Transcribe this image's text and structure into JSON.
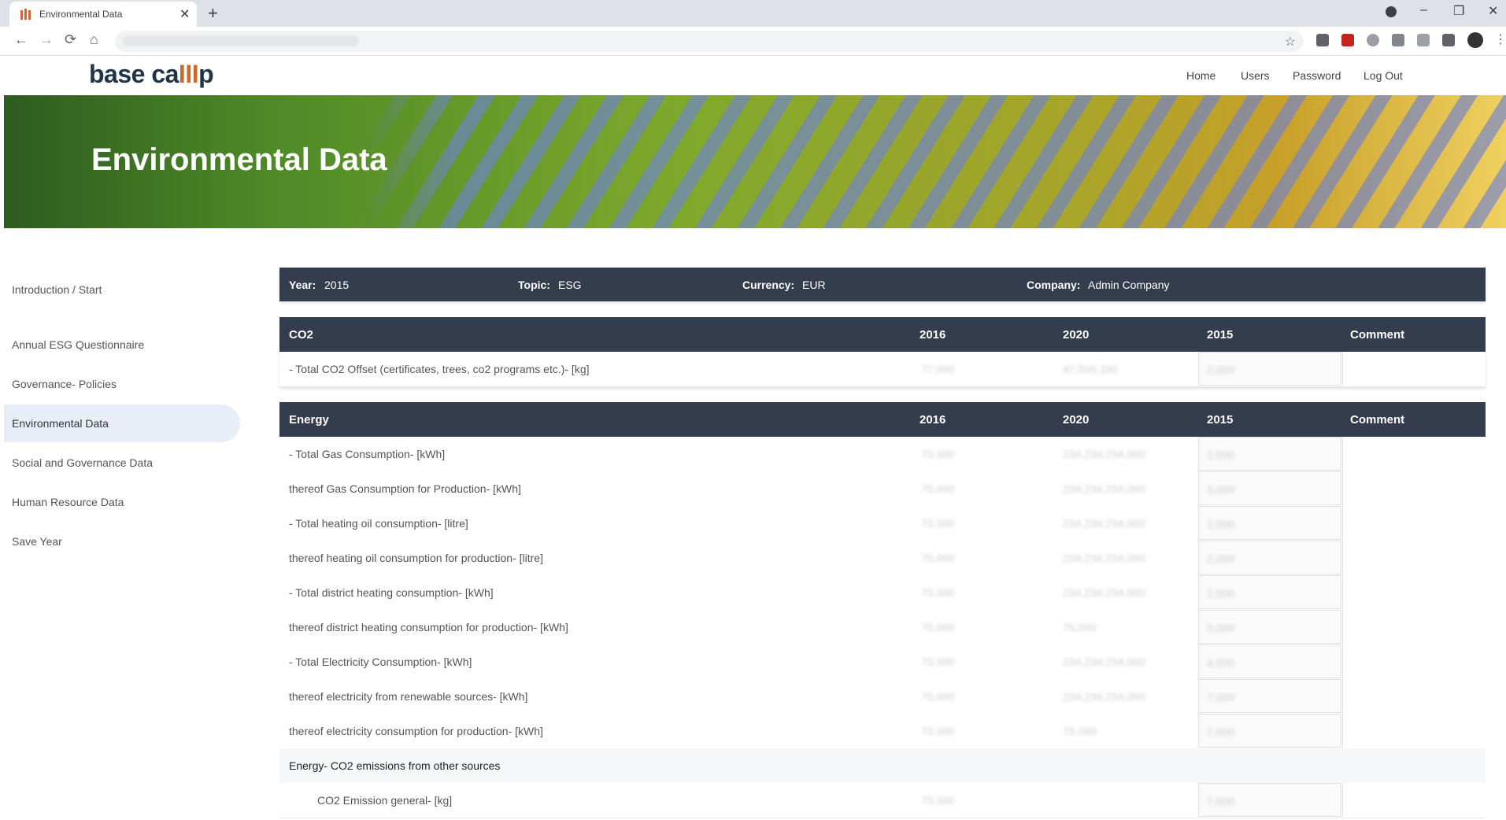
{
  "browser": {
    "tab_title": "Environmental Data",
    "tab_close": "✕",
    "new_tab": "+",
    "back": "←",
    "forward": "→",
    "reload": "⟳",
    "home": "⌂",
    "star": "☆",
    "minimize": "–",
    "restore": "❐",
    "close": "✕"
  },
  "site": {
    "logo_a": "base ca",
    "logo_b": "III",
    "logo_c": "p",
    "nav": [
      "Home",
      "Users",
      "Password",
      "Log Out"
    ],
    "hero_title": "Environmental Data"
  },
  "sidebar": {
    "items": [
      {
        "label": "Introduction / Start"
      },
      {
        "label": "Annual ESG Questionnaire"
      },
      {
        "label": "Governance- Policies"
      },
      {
        "label": "Environmental Data",
        "active": true
      },
      {
        "label": "Social and Governance Data"
      },
      {
        "label": "Human Resource Data"
      },
      {
        "label": "Save Year"
      }
    ]
  },
  "info": {
    "year_label": "Year:",
    "year": "2015",
    "topic_label": "Topic:",
    "topic": "ESG",
    "currency_label": "Currency:",
    "currency": "EUR",
    "company_label": "Company:",
    "company": "Admin Company"
  },
  "co2": {
    "title": "CO2",
    "col1": "2016",
    "col2": "2020",
    "col3": "2015",
    "col4": "Comment",
    "rows": [
      {
        "label": "- Total CO2 Offset (certificates, trees, co2 programs etc.)- [kg]",
        "v1": "77,000",
        "v2": "47,500,190",
        "v3": "2,000"
      }
    ]
  },
  "energy": {
    "title": "Energy",
    "col1": "2016",
    "col2": "2020",
    "col3": "2015",
    "col4": "Comment",
    "rows": [
      {
        "label": "- Total Gas Consumption- [kWh]",
        "v1": "75,000",
        "v2": "234,234,234,000",
        "v3": "2,000"
      },
      {
        "label": "thereof Gas Consumption for Production- [kWh]",
        "v1": "75,000",
        "v2": "234,234,234,000",
        "v3": "3,000"
      },
      {
        "label": "- Total heating oil consumption- [litre]",
        "v1": "75,000",
        "v2": "234,234,234,000",
        "v3": "2,000"
      },
      {
        "label": "thereof heating oil consumption for production- [litre]",
        "v1": "75,000",
        "v2": "234,234,234,000",
        "v3": "2,000"
      },
      {
        "label": "- Total district heating consumption- [kWh]",
        "v1": "75,000",
        "v2": "234,234,234,000",
        "v3": "2,000"
      },
      {
        "label": "thereof district heating consumption for production- [kWh]",
        "v1": "75,000",
        "v2": "75,000",
        "v3": "5,000"
      },
      {
        "label": "- Total Electricity Consumption- [kWh]",
        "v1": "75,000",
        "v2": "234,234,234,000",
        "v3": "4,000"
      },
      {
        "label": "thereof electricity from renewable sources- [kWh]",
        "v1": "75,000",
        "v2": "234,234,234,000",
        "v3": "7,000"
      },
      {
        "label": "thereof electricity consumption for production- [kWh]",
        "v1": "75,000",
        "v2": "75,000",
        "v3": "7,000"
      }
    ],
    "subhead": "Energy- CO2 emissions from other sources",
    "subrows": [
      {
        "label": "CO2 Emission general- [kg]",
        "v1": "75,000",
        "v2": "",
        "v3": "7,000"
      }
    ]
  }
}
